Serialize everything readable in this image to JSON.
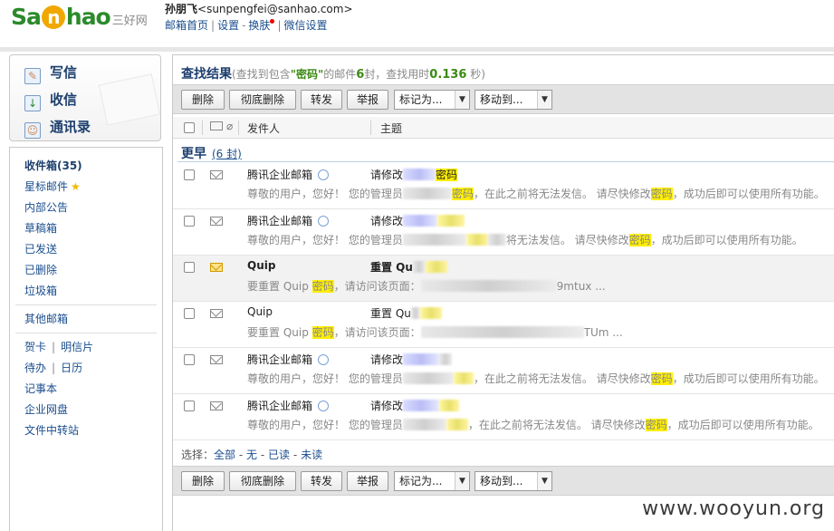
{
  "header": {
    "logo_text_a": "Sa",
    "logo_text_o": "n",
    "logo_text_b": "hao",
    "logo_cn": "三好网",
    "user_name": "孙朋飞",
    "user_email": "<sunpengfei@sanhao.com>",
    "links": [
      "邮箱首页",
      "设置",
      "换肤",
      "微信设置"
    ],
    "sep_bar": "|",
    "sep_dash": "-"
  },
  "quick": {
    "compose": "写信",
    "receive": "收信",
    "contacts": "通讯录"
  },
  "folders": {
    "inbox": "收件箱(35)",
    "starred": "星标邮件",
    "internal": "内部公告",
    "drafts": "草稿箱",
    "sent": "已发送",
    "deleted": "已删除",
    "spam": "垃圾箱",
    "other": "其他邮箱",
    "card": "贺卡",
    "postcard": "明信片",
    "todo": "待办",
    "calendar": "日历",
    "notes": "记事本",
    "netdisk": "企业网盘",
    "transfer": "文件中转站",
    "star_glyph": "★",
    "sep": "|"
  },
  "search": {
    "title": "查找结果",
    "sub_prefix": "(查找到包含",
    "keyword": "\"密码\"",
    "sub_mid": "的邮件",
    "count": "6",
    "sub_mid2": "封，查找用时",
    "time": "0.136",
    "sub_suffix": "秒)"
  },
  "toolbar": {
    "delete": "删除",
    "perm_delete": "彻底删除",
    "forward": "转发",
    "report": "举报",
    "mark_as": "标记为...",
    "move_to": "移动到...",
    "arrow": "▼"
  },
  "columns": {
    "sender": "发件人",
    "subject": "主题"
  },
  "group": {
    "label": "更早",
    "count": "(6 封)"
  },
  "emails": [
    {
      "sender": "腾讯企业邮箱",
      "subj_a": "请修改",
      "subj_b": "密码",
      "prev_a": "尊敬的用户，您好！ 您的管理员",
      "prev_b": "密码",
      "prev_c": "，在此之前将无法发信。 请尽快修改",
      "prev_d": "密码",
      "prev_e": "，成功后即可以使用所有功能。"
    },
    {
      "sender": "腾讯企业邮箱",
      "subj_a": "请修改",
      "subj_b": "",
      "prev_a": "尊敬的用户，您好！ 您的管理员",
      "prev_b": "",
      "prev_c": "将无法发信。 请尽快修改",
      "prev_d": "密码",
      "prev_e": "，成功后即可以使用所有功能。"
    },
    {
      "sender": "Quip",
      "subj_a": "重置 Qu",
      "subj_b": "",
      "prev_a": "要重置 Quip ",
      "prev_b": "密码",
      "prev_c": "，请访问该页面：",
      "prev_d": "9mtux ...",
      "prev_e": ""
    },
    {
      "sender": "Quip",
      "subj_a": "重置 Qu",
      "subj_b": "",
      "prev_a": "要重置 Quip ",
      "prev_b": "密码",
      "prev_c": "，请访问该页面：",
      "prev_d": "TUm ...",
      "prev_e": ""
    },
    {
      "sender": "腾讯企业邮箱",
      "subj_a": "请修改",
      "subj_b": "",
      "prev_a": "尊敬的用户，您好！ 您的管理员",
      "prev_b": "",
      "prev_c": "，在此之前将无法发信。 请尽快修改",
      "prev_d": "密码",
      "prev_e": "，成功后即可以使用所有功能。"
    },
    {
      "sender": "腾讯企业邮箱",
      "subj_a": "请修改",
      "subj_b": "",
      "prev_a": "尊敬的用户，您好！ 您的管理员",
      "prev_b": "",
      "prev_c": "，在此之前将无法发信。 请尽快修改",
      "prev_d": "密码",
      "prev_e": "，成功后即可以使用所有功能。"
    }
  ],
  "select": {
    "label": "选择：",
    "all": "全部",
    "none": "无",
    "read": "已读",
    "unread": "未读",
    "dash": "-"
  },
  "watermark": "www.wooyun.org"
}
